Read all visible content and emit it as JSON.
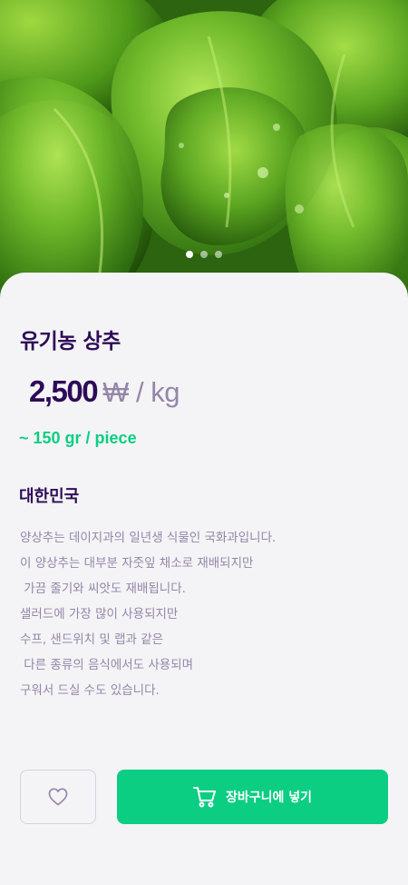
{
  "product": {
    "name": "유기농 상추",
    "price": "2,500",
    "currency_unit": "₩ / kg",
    "piece_weight": "~ 150 gr / piece",
    "origin": "대한민국",
    "description": "양상추는 데이지과의 일년생 식물인 국화과입니다.\n이 양상추는 대부분 자줏잎 채소로 재배되지만\n 가끔 줄기와 씨앗도 재배됩니다.\n샐러드에 가장 많이 사용되지만\n수프, 샌드위치 및 랩과 같은\n 다른 종류의 음식에서도 사용되며\n구워서 드실 수도 있습니다."
  },
  "carousel": {
    "total": 3,
    "active_index": 0
  },
  "actions": {
    "favorite_icon": "heart-icon",
    "cart_icon": "shopping-cart-icon",
    "cart_label": "장바구니에 넣기"
  },
  "colors": {
    "title": "#2d0c57",
    "muted": "#9586a8",
    "accent": "#0bce83",
    "background": "#f4f4f6"
  }
}
